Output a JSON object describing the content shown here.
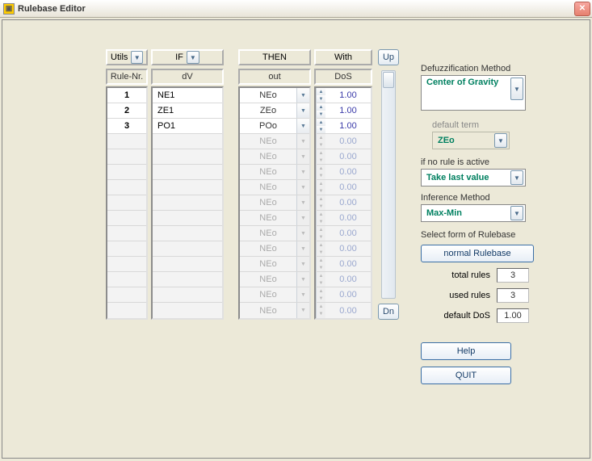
{
  "window": {
    "title": "Rulebase Editor"
  },
  "headers": {
    "utils": "Utils",
    "if": "IF",
    "then": "THEN",
    "with": "With",
    "rule_nr": "Rule-Nr.",
    "dv": "dV",
    "out": "out",
    "dos": "DoS"
  },
  "rows": [
    {
      "nr": "1",
      "dv": "NE1",
      "out": "NEo",
      "dos": "1.00",
      "active": true
    },
    {
      "nr": "2",
      "dv": "ZE1",
      "out": "ZEo",
      "dos": "1.00",
      "active": true
    },
    {
      "nr": "3",
      "dv": "PO1",
      "out": "POo",
      "dos": "1.00",
      "active": true
    },
    {
      "nr": "",
      "dv": "",
      "out": "NEo",
      "dos": "0.00",
      "active": false
    },
    {
      "nr": "",
      "dv": "",
      "out": "NEo",
      "dos": "0.00",
      "active": false
    },
    {
      "nr": "",
      "dv": "",
      "out": "NEo",
      "dos": "0.00",
      "active": false
    },
    {
      "nr": "",
      "dv": "",
      "out": "NEo",
      "dos": "0.00",
      "active": false
    },
    {
      "nr": "",
      "dv": "",
      "out": "NEo",
      "dos": "0.00",
      "active": false
    },
    {
      "nr": "",
      "dv": "",
      "out": "NEo",
      "dos": "0.00",
      "active": false
    },
    {
      "nr": "",
      "dv": "",
      "out": "NEo",
      "dos": "0.00",
      "active": false
    },
    {
      "nr": "",
      "dv": "",
      "out": "NEo",
      "dos": "0.00",
      "active": false
    },
    {
      "nr": "",
      "dv": "",
      "out": "NEo",
      "dos": "0.00",
      "active": false
    },
    {
      "nr": "",
      "dv": "",
      "out": "NEo",
      "dos": "0.00",
      "active": false
    },
    {
      "nr": "",
      "dv": "",
      "out": "NEo",
      "dos": "0.00",
      "active": false
    },
    {
      "nr": "",
      "dv": "",
      "out": "NEo",
      "dos": "0.00",
      "active": false
    }
  ],
  "updn": {
    "up": "Up",
    "dn": "Dn"
  },
  "right": {
    "defuzz_label": "Defuzzification Method",
    "defuzz_value": "Center of Gravity",
    "default_term_label": "default term",
    "default_term_value": "ZEo",
    "if_no_rule_label": "if no rule is active",
    "if_no_rule_value": "Take last value",
    "inference_label": "Inference Method",
    "inference_value": "Max-Min",
    "select_form_label": "Select form of Rulebase",
    "normal_rulebase": "normal Rulebase",
    "total_rules_label": "total rules",
    "total_rules_value": "3",
    "used_rules_label": "used rules",
    "used_rules_value": "3",
    "default_dos_label": "default DoS",
    "default_dos_value": "1.00",
    "help": "Help",
    "quit": "QUIT"
  }
}
